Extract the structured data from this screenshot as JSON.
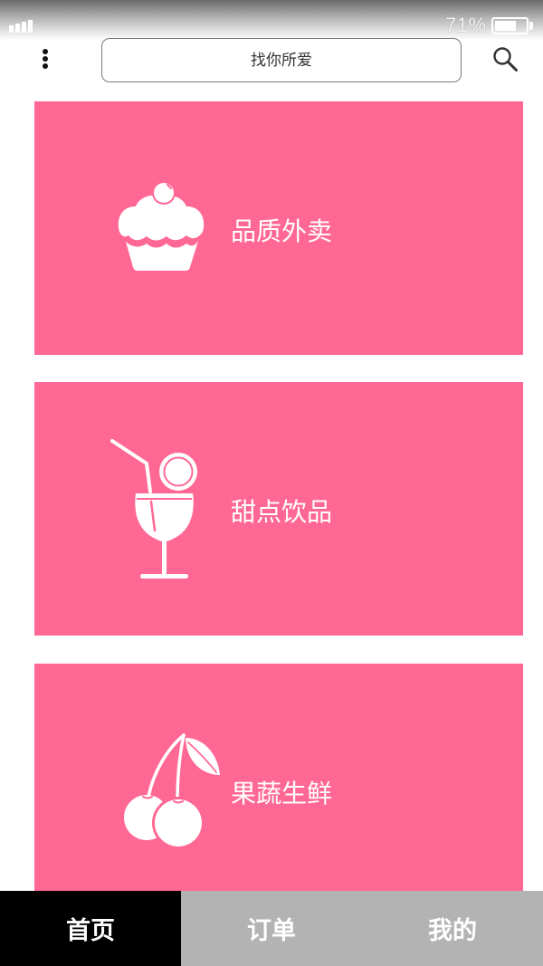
{
  "status_bar": {
    "signal_icon": "signal-icon",
    "signal_bars": 4,
    "battery_text": "71%",
    "battery_level": 0.71,
    "battery_icon": "battery-icon"
  },
  "header": {
    "menu_icon": "more-vertical-icon",
    "search_placeholder": "找你所爱",
    "search_icon": "search-icon"
  },
  "categories": [
    {
      "label": "品质外卖",
      "icon": "cupcake-icon"
    },
    {
      "label": "甜点饮品",
      "icon": "cocktail-icon"
    },
    {
      "label": "果蔬生鲜",
      "icon": "cherry-icon"
    }
  ],
  "tabbar": {
    "items": [
      {
        "label": "首页",
        "active": true
      },
      {
        "label": "订单",
        "active": false
      },
      {
        "label": "我的",
        "active": false
      }
    ]
  },
  "colors": {
    "accent": "#FF6894",
    "tab_active_bg": "#000000",
    "tab_bg": "#B3B3B3",
    "text_on_accent": "#FFFFFF"
  }
}
